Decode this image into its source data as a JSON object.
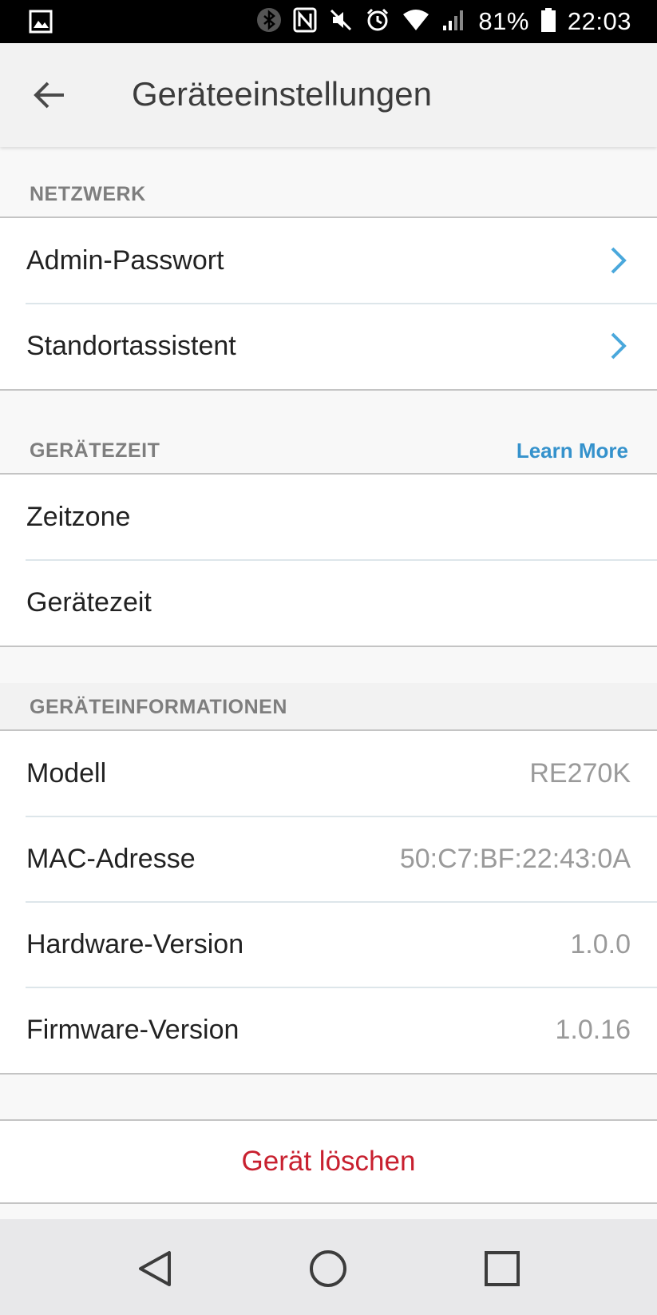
{
  "status_bar": {
    "battery_percent": "81%",
    "time": "22:03",
    "icons": [
      "gallery-icon",
      "bluetooth-icon",
      "nfc-icon",
      "mute-icon",
      "alarm-icon",
      "wifi-icon",
      "signal-icon",
      "battery-icon"
    ]
  },
  "app_bar": {
    "title": "Geräteeinstellungen",
    "back_icon": "arrow-left-icon"
  },
  "sections": {
    "network": {
      "header": "NETZWERK",
      "items": [
        {
          "label": "Admin-Passwort"
        },
        {
          "label": "Standortassistent"
        }
      ]
    },
    "device_time": {
      "header": "GERÄTEZEIT",
      "link": "Learn More",
      "items": [
        {
          "label": "Zeitzone"
        },
        {
          "label": "Gerätezeit"
        }
      ]
    },
    "device_info": {
      "header": "GERÄTEINFORMATIONEN",
      "items": [
        {
          "label": "Modell",
          "value": "RE270K"
        },
        {
          "label": "MAC-Adresse",
          "value": "50:C7:BF:22:43:0A"
        },
        {
          "label": "Hardware-Version",
          "value": "1.0.0"
        },
        {
          "label": "Firmware-Version",
          "value": "1.0.16"
        }
      ]
    }
  },
  "delete_button": {
    "label": "Gerät löschen"
  },
  "colors": {
    "accent": "#3592cc",
    "chevron": "#4aa8dc",
    "danger": "#c8202f",
    "header_text": "#7e7e7e"
  },
  "nav_bar": {
    "buttons": [
      "back-triangle-icon",
      "home-circle-icon",
      "recents-square-icon"
    ]
  }
}
